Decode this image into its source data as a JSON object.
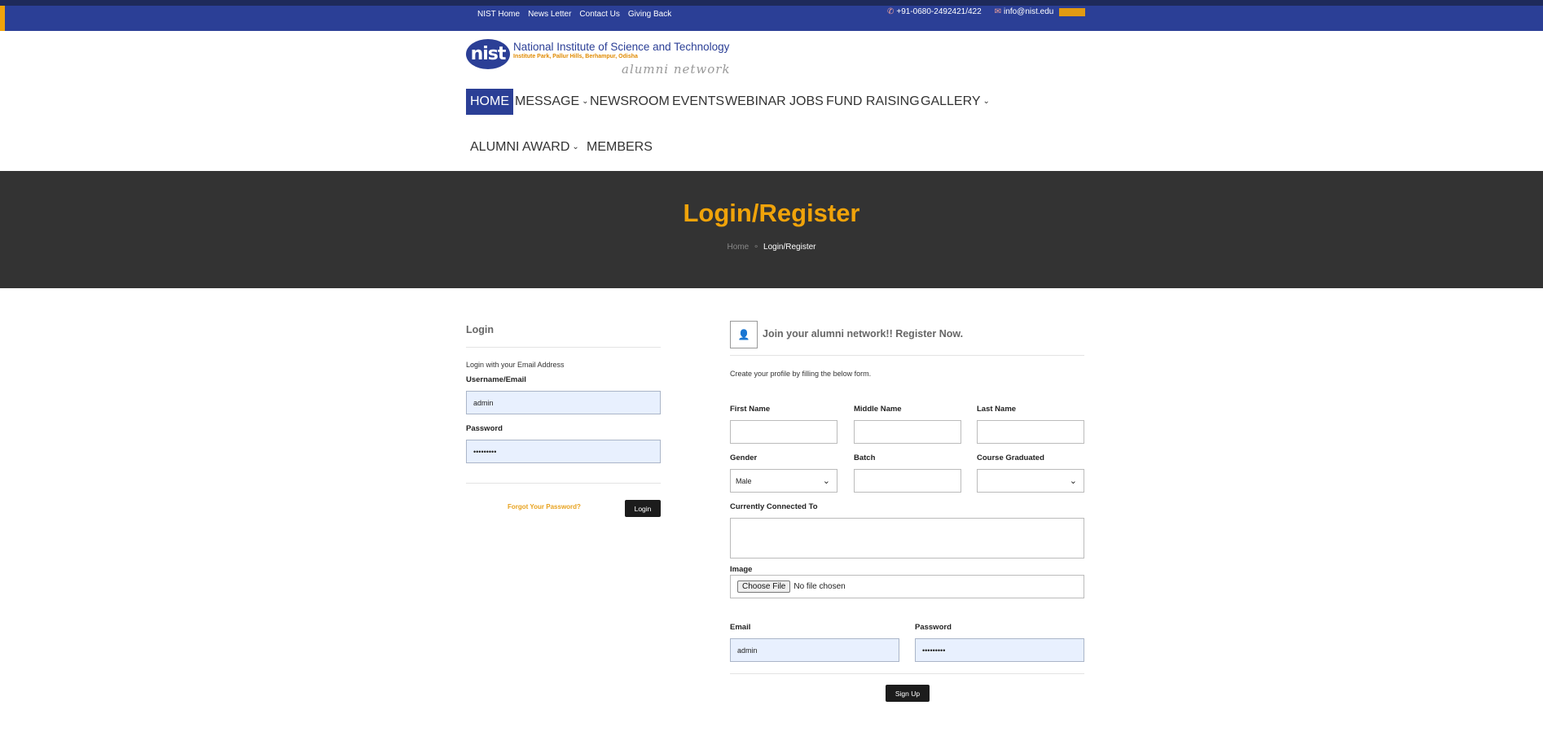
{
  "topbar": {
    "links": [
      "NIST Home",
      "News Letter",
      "Contact Us",
      "Giving Back"
    ],
    "phone": "+91-0680-2492421/422",
    "email": "info@nist.edu",
    "accent_color": "#f0a30a",
    "bar_color": "#2b3f96"
  },
  "logo": {
    "emblem": "nist",
    "title": "National Institute of Science and Technology",
    "subtitle": "Institute Park, Pallur Hills, Berhampur, Odisha",
    "script": "alumni network"
  },
  "nav": {
    "items": [
      {
        "label": "HOME",
        "dropdown": false,
        "active": true
      },
      {
        "label": "MESSAGE",
        "dropdown": true
      },
      {
        "label": "NEWSROOM",
        "dropdown": false
      },
      {
        "label": "EVENTS",
        "dropdown": false
      },
      {
        "label": "WEBINAR",
        "dropdown": false
      },
      {
        "label": "JOBS",
        "dropdown": false
      },
      {
        "label": "FUND RAISING",
        "dropdown": false
      },
      {
        "label": "GALLERY",
        "dropdown": true
      },
      {
        "label": "ALUMNI AWARD",
        "dropdown": true
      },
      {
        "label": "MEMBERS",
        "dropdown": false
      }
    ]
  },
  "banner": {
    "title": "Login/Register",
    "breadcrumb_home": "Home",
    "breadcrumb_current": "Login/Register"
  },
  "login": {
    "title": "Login",
    "intro": "Login with your Email Address",
    "username_label": "Username/Email",
    "username_value": "admin",
    "password_label": "Password",
    "password_value": "•••••••••",
    "forgot": "Forgot Your Password?",
    "button": "Login"
  },
  "register": {
    "heading": "Join your alumni network!! Register Now.",
    "intro": "Create your profile by filling the below form.",
    "first_name_label": "First Name",
    "middle_name_label": "Middle Name",
    "last_name_label": "Last Name",
    "gender_label": "Gender",
    "gender_value": "Male",
    "batch_label": "Batch",
    "course_label": "Course Graduated",
    "course_value": "",
    "connected_label": "Currently Connected To",
    "image_label": "Image",
    "file_button": "Choose File",
    "file_status": "No file chosen",
    "email_label": "Email",
    "email_value": "admin",
    "password_label": "Password",
    "password_value": "•••••••••",
    "button": "Sign Up"
  }
}
